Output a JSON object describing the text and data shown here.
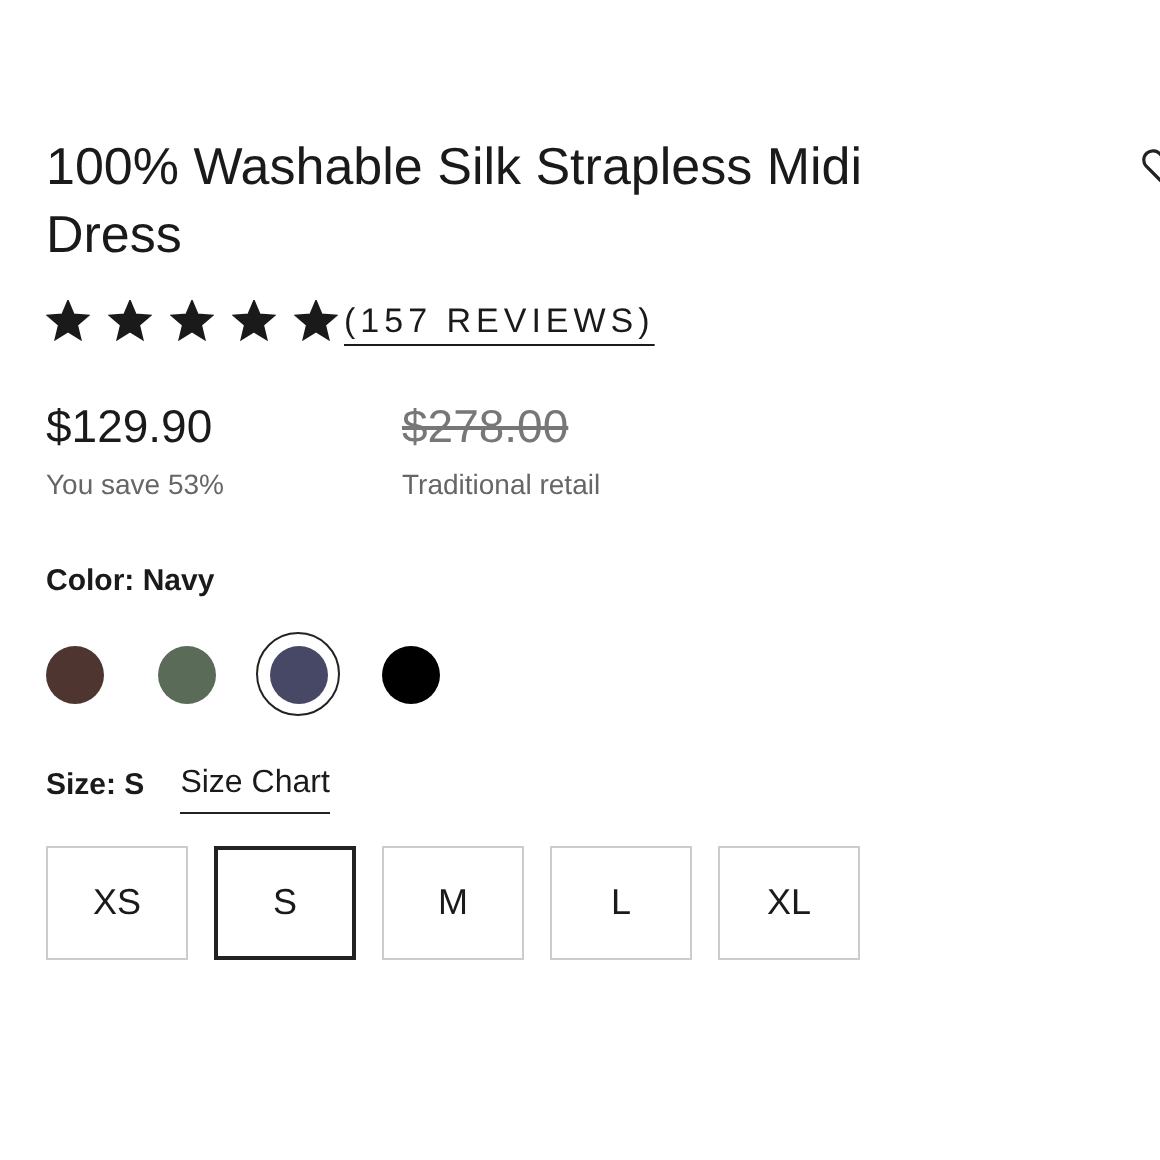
{
  "product": {
    "title": "100% Washable Silk Strapless Midi Dress",
    "stars": 5,
    "reviews": "(157 REVIEWS)"
  },
  "price": {
    "current": "$129.90",
    "savings": "You save 53%",
    "original": "$278.00",
    "original_label": "Traditional retail"
  },
  "color": {
    "label": "Color: Navy",
    "swatches": [
      {
        "color": "#4e3530",
        "selected": false
      },
      {
        "color": "#5a6b58",
        "selected": false
      },
      {
        "color": "#464865",
        "selected": true
      },
      {
        "color": "#000000",
        "selected": false
      }
    ]
  },
  "size": {
    "label": "Size: S",
    "chart_link": "Size Chart",
    "options": [
      {
        "label": "XS",
        "selected": false
      },
      {
        "label": "S",
        "selected": true
      },
      {
        "label": "M",
        "selected": false
      },
      {
        "label": "L",
        "selected": false
      },
      {
        "label": "XL",
        "selected": false
      }
    ]
  }
}
